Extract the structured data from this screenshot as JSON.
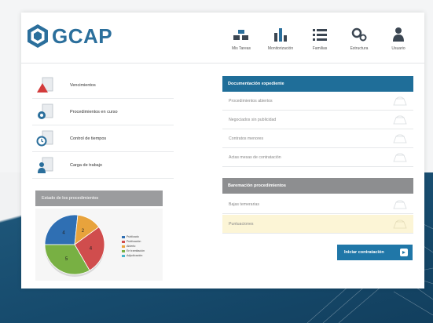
{
  "brand": {
    "name": "GCAP",
    "color": "#2b6f9c"
  },
  "nav": [
    {
      "label": "Mis Tareas",
      "icon": "tasks-icon"
    },
    {
      "label": "Monitorización",
      "icon": "bar-chart-icon"
    },
    {
      "label": "Familias",
      "icon": "list-icon"
    },
    {
      "label": "Estructura",
      "icon": "gears-icon"
    },
    {
      "label": "Usuario",
      "icon": "user-icon"
    }
  ],
  "left_menu": [
    {
      "label": "Vencimientos",
      "icon": "alert-document-icon"
    },
    {
      "label": "Procedimientos en curso",
      "icon": "gear-document-icon"
    },
    {
      "label": "Control de tiempos",
      "icon": "clock-document-icon"
    },
    {
      "label": "Carga de trabajo",
      "icon": "person-document-icon"
    }
  ],
  "estado": {
    "title": "Estado de los procedimientos",
    "chart_data": {
      "type": "pie",
      "slices": [
        {
          "label": "4",
          "value": 4,
          "color": "#2f6fb3"
        },
        {
          "label": "2",
          "value": 2,
          "color": "#e8a33c"
        },
        {
          "label": "4",
          "value": 4,
          "color": "#d04d4d"
        },
        {
          "label": "5",
          "value": 5,
          "color": "#78b043"
        }
      ],
      "legend": [
        {
          "label": "Publicado",
          "color": "#2f6fb3"
        },
        {
          "label": "Publicación",
          "color": "#d04d4d"
        },
        {
          "label": "Abierto",
          "color": "#e8a33c"
        },
        {
          "label": "En tramitación",
          "color": "#78b043"
        },
        {
          "label": "Adjudicación",
          "color": "#45b5c9"
        }
      ]
    }
  },
  "documentacion": {
    "title": "Documentación expediente",
    "rows": [
      "Procedimientos abiertos",
      "Negociados sin publicidad",
      "Contratos menores",
      "Actas mesas de contratación"
    ]
  },
  "baremacion": {
    "title": "Baremación procedimientos",
    "rows": [
      "Bajas temerarias",
      "Puntuaciones"
    ]
  },
  "cta": {
    "label": "Iniciar contratación"
  }
}
